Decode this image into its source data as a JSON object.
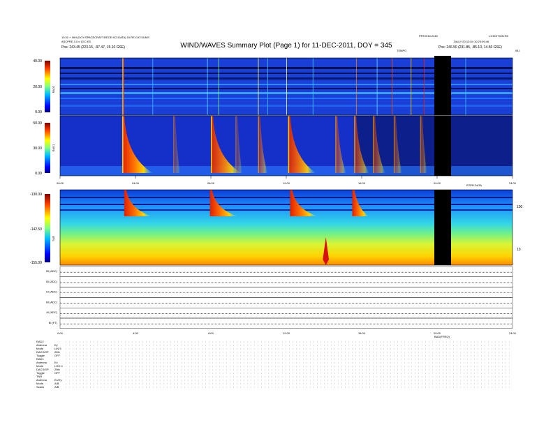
{
  "header": {
    "title": "WIND/WAVES Summary Plot (Page 1) for 11-DEC-2011, DOY = 345",
    "orbit_left_1": "10:32 + 18H (DOY:SPACECRAFT:RECE:SCI:DATA) 10:RE:CAT:SUMS",
    "orbit_left_2": "ASCPRE 3.0.x 10:C:E5",
    "pos_left": "Pos:  243.45 (223.15, -97.47, 15.10 GSE)",
    "right_top_1": "PRT2010:2440",
    "right_top_2": "L3 EDITION:R3",
    "right_mid": "DAILY 20:13:04 10:23:09:46",
    "pos_right": "Pos:  246.50 (231.85, -85.10, 14.50 GSE)",
    "mid_tag": "TEMPO",
    "right_tag": "041"
  },
  "chart_data": [
    {
      "type": "heatmap",
      "name_tag": "RAD2",
      "ylabel": "RAD2",
      "ytick_labels": [
        "40.00",
        "20.00",
        "0.00"
      ],
      "ylim": [
        0,
        40
      ],
      "colorbar": "jet"
    },
    {
      "type": "heatmap",
      "name_tag": "RAD1",
      "ylabel": "RAD1",
      "ytick_labels": [
        "50.00",
        "30.00",
        "0.00"
      ],
      "ylim": [
        0,
        50
      ],
      "colorbar": "jet",
      "x_tick_labels": [
        "00:00",
        "04:00",
        "08:00",
        "12:00",
        "16:00",
        "20:00",
        "24:00"
      ],
      "x_extra_label": "RTPR:DATA"
    },
    {
      "type": "heatmap",
      "name_tag": "TNR",
      "ylabel": "TNR",
      "ytick_labels": [
        "-130.00",
        "-142.50",
        "-155.00"
      ],
      "ylim": [
        -155,
        -130
      ],
      "right_tick_labels": [
        "100",
        "10"
      ],
      "colorbar": "jet"
    },
    {
      "type": "line",
      "name_tag": "timeseries",
      "channels": [
        "Bl (ADC)",
        "Bl (ADC)",
        "Cl (ADC)",
        "Bl (ADC)",
        "Al (ADC)",
        "Bl (FT)"
      ],
      "x_tick_labels": [
        "0:00",
        "4:00",
        "8:00",
        "12:00",
        "16:00",
        "20:00",
        "24:00"
      ],
      "x_extra_label": "BAD(FREQ)"
    }
  ],
  "status_table": {
    "rows": [
      [
        "RAD2",
        ""
      ],
      [
        "Antenna",
        "Ey"
      ],
      [
        "Mode",
        "LIN 5"
      ],
      [
        "DACS/SP",
        "26th"
      ],
      [
        "Toggle",
        "OFF"
      ],
      [
        "RAD1",
        ""
      ],
      [
        "Antenna",
        "Ex"
      ],
      [
        "Mode",
        "LOG 4"
      ],
      [
        "DACS/SP",
        "25th"
      ],
      [
        "Toggle",
        "OFF"
      ],
      [
        "TNR",
        ""
      ],
      [
        "Antenna",
        "Ex/Ey"
      ],
      [
        "Mode",
        "A/B"
      ],
      [
        "Scans",
        "A/B"
      ]
    ]
  },
  "colors": {
    "background": "#ffffff",
    "data_gap": "#000000"
  }
}
